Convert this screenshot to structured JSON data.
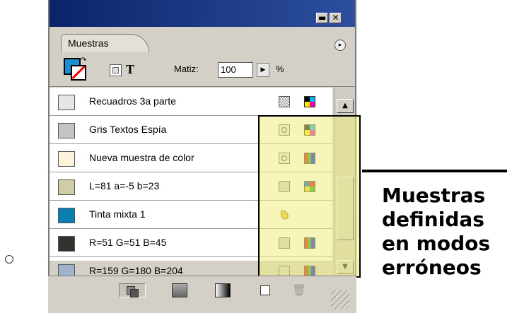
{
  "window": {
    "minimize_glyph": "▬",
    "close_glyph": "✕"
  },
  "panel": {
    "tab_label": "Muestras",
    "menu_glyph": "▸"
  },
  "controls": {
    "text_glyph": "T",
    "tint_label": "Matiz:",
    "tint_value": "100",
    "tint_step_glyph": "▶",
    "tint_unit": "%"
  },
  "swatches": [
    {
      "label": "Recuadros 3a parte",
      "color": "#e6e6e6",
      "type_icon": "process-icon",
      "mode_icon": "cmyk-icon"
    },
    {
      "label": "Gris Textos Espía",
      "color": "#c4c4c4",
      "type_icon": "spot-icon",
      "mode_icon": "cmyk-icon"
    },
    {
      "label": "Nueva muestra de color",
      "color": "#fdf3dc",
      "type_icon": "spot-icon",
      "mode_icon": "rgb-icon"
    },
    {
      "label": "L=81 a=-5 b=23",
      "color": "#d0cca6",
      "type_icon": "process-icon",
      "mode_icon": "lab-icon"
    },
    {
      "label": "Tinta mixta 1",
      "color": "#0a7fb1",
      "type_icon": "mixed-ink-icon",
      "mode_icon": ""
    },
    {
      "label": "R=51 G=51 B=45",
      "color": "#33332d",
      "type_icon": "process-icon",
      "mode_icon": "rgb-icon"
    },
    {
      "label": "R=159 G=180 B=204",
      "color": "#9fb4cc",
      "type_icon": "process-icon",
      "mode_icon": "rgb-icon"
    }
  ],
  "scrollbar": {
    "up_glyph": "▲",
    "down_glyph": "▼"
  },
  "bottom_toolbar": {
    "trash_glyph": "🗑"
  },
  "callout": {
    "lines": [
      "Muestras",
      "definidas",
      "en modos",
      "erróneos"
    ]
  },
  "colors": {
    "highlight": "#eeee82",
    "title_bar": "#0f2a78"
  }
}
